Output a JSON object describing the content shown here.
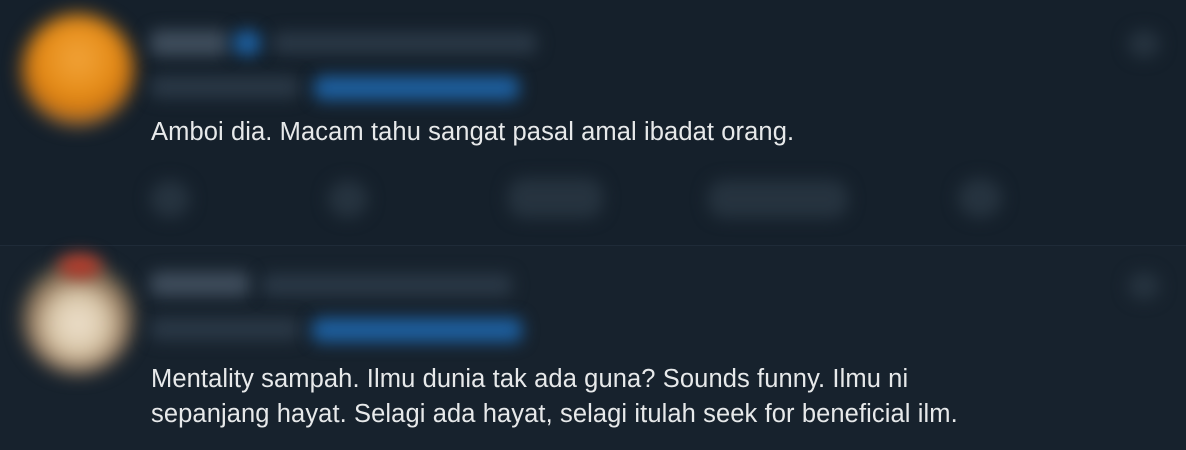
{
  "tweets": [
    {
      "text_lines": [
        "Amboi dia. Macam tahu sangat pasal amal ibadat orang."
      ]
    },
    {
      "text_lines": [
        "Mentality sampah. Ilmu dunia tak ada guna? Sounds funny. Ilmu ni",
        "sepanjang hayat. Selagi ada hayat, selagi itulah seek for beneficial ilm."
      ]
    }
  ],
  "colors": {
    "background": "#15202b",
    "text": "#e7e9ea",
    "link_blue": "#1d9bf0"
  },
  "icons": [
    "reply-icon",
    "retweet-icon",
    "like-icon",
    "views-icon",
    "share-icon",
    "more-icon",
    "verified-badge-icon"
  ]
}
